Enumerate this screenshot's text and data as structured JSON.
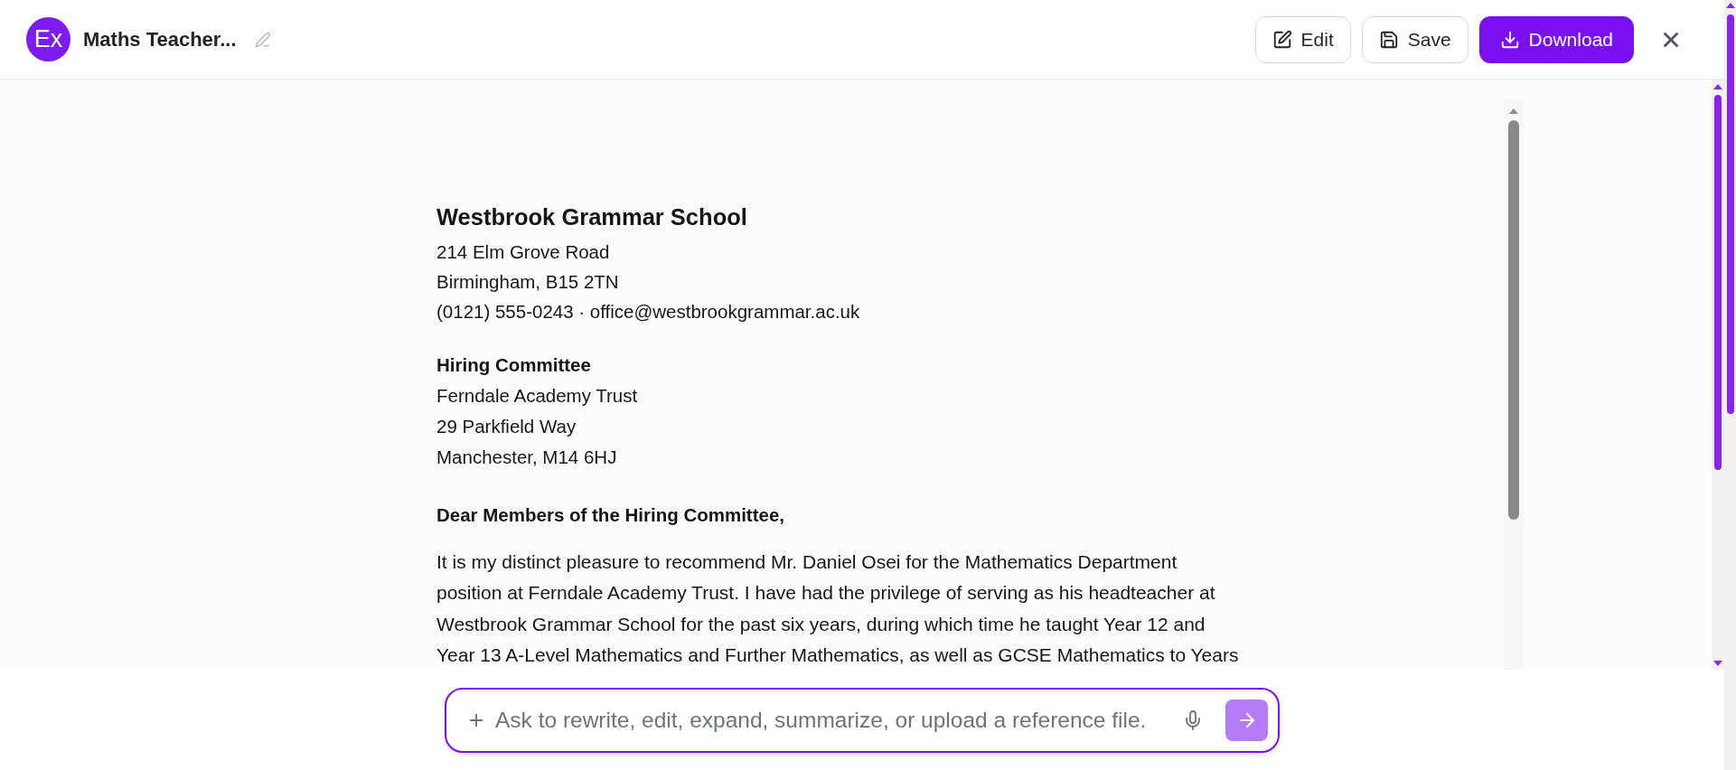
{
  "header": {
    "avatar": "Ex",
    "title": "Maths Teacher...",
    "buttons": [
      {
        "label": "Edit",
        "kind": "edit",
        "primary": false
      },
      {
        "label": "Save",
        "kind": "save",
        "primary": false
      },
      {
        "label": "Download",
        "kind": "download",
        "primary": true
      }
    ]
  },
  "letter": {
    "sender": {
      "name": "Westbrook Grammar School",
      "lines": [
        "214 Elm Grove Road",
        "Birmingham, B15 2TN",
        "(0121) 555-0243 · office@westbrookgrammar.ac.uk"
      ]
    },
    "recipient": {
      "heading": "Hiring Committee",
      "lines": [
        "Ferndale Academy Trust",
        "29 Parkfield Way",
        "Manchester, M14 6HJ"
      ]
    },
    "salutation": "Dear Members of the Hiring Committee,",
    "paragraphs": [
      {
        "lines": [
          "It is my distinct pleasure to recommend Mr. Daniel Osei for the Mathematics Department",
          "position at Ferndale Academy Trust. I have had the privilege of serving as his headteacher at",
          "Westbrook Grammar School for the past six years, during which time he taught Year 12 and",
          "Year 13 A-Level Mathematics and Further Mathematics, as well as GCSE Mathematics to Years"
        ]
      }
    ]
  },
  "prompt": {
    "placeholder": "Ask to rewrite, edit, expand, summarize, or upload a reference file.",
    "send_disabled": true
  }
}
